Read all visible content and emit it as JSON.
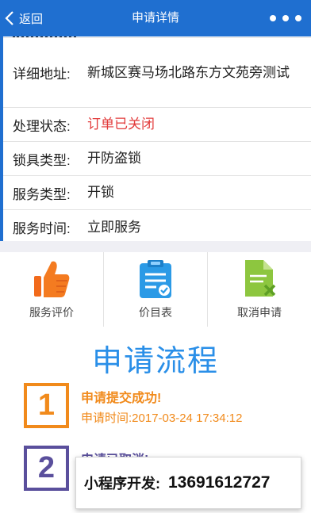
{
  "navbar": {
    "back_label": "返回",
    "title": "申请详情"
  },
  "info": {
    "rows": [
      {
        "label": "详细地址:",
        "value": "新城区赛马场北路东方文苑旁测试"
      },
      {
        "label": "处理状态:",
        "value": "订单已关闭"
      },
      {
        "label": "锁具类型:",
        "value": "开防盗锁"
      },
      {
        "label": "服务类型:",
        "value": "开锁"
      },
      {
        "label": "服务时间:",
        "value": "立即服务"
      }
    ]
  },
  "actions": [
    {
      "label": "服务评价",
      "icon": "thumbs-up-icon"
    },
    {
      "label": "价目表",
      "icon": "clipboard-check-icon"
    },
    {
      "label": "取消申请",
      "icon": "cancel-document-icon"
    }
  ],
  "process": {
    "title": "申请流程",
    "steps": [
      {
        "number": "1",
        "title": "申请提交成功!",
        "time": "申请时间:2017-03-24 17:34:12"
      },
      {
        "number": "2",
        "title": "申请已取消!"
      }
    ]
  },
  "promo": {
    "label": "小程序开发:",
    "phone": "13691612727"
  },
  "colors": {
    "primary": "#1f6fd0",
    "status_red": "#e23b3b",
    "orange": "#f18a1b",
    "purple": "#5a4f9c",
    "title_blue": "#2a8fe8"
  }
}
